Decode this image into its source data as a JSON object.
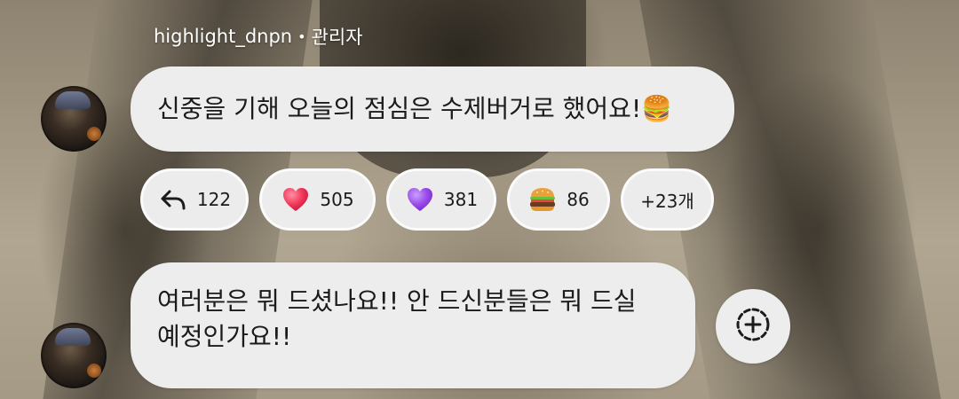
{
  "header": {
    "username": "highlight_dnpn",
    "separator": "•",
    "role": "관리자"
  },
  "messages": [
    {
      "text": "신중을 기해 오늘의 점심은 수제버거로 했어요!🍔"
    },
    {
      "lines": [
        "여러분은 뭐 드셨나요!! 안 드신분들은 뭐 드실",
        "예정인가요!!"
      ]
    }
  ],
  "reactions": [
    {
      "icon": "reply-arrow-icon",
      "count": "122"
    },
    {
      "icon": "red-heart-icon",
      "count": "505"
    },
    {
      "icon": "purple-heart-icon",
      "count": "381"
    },
    {
      "icon": "hamburger-icon",
      "count": "86"
    },
    {
      "icon": "",
      "count": "+23개"
    }
  ],
  "colors": {
    "bubble": "#ededed",
    "text": "#1b1b1b",
    "red_heart": "#f2385a",
    "purple_heart": "#9b4dea"
  }
}
